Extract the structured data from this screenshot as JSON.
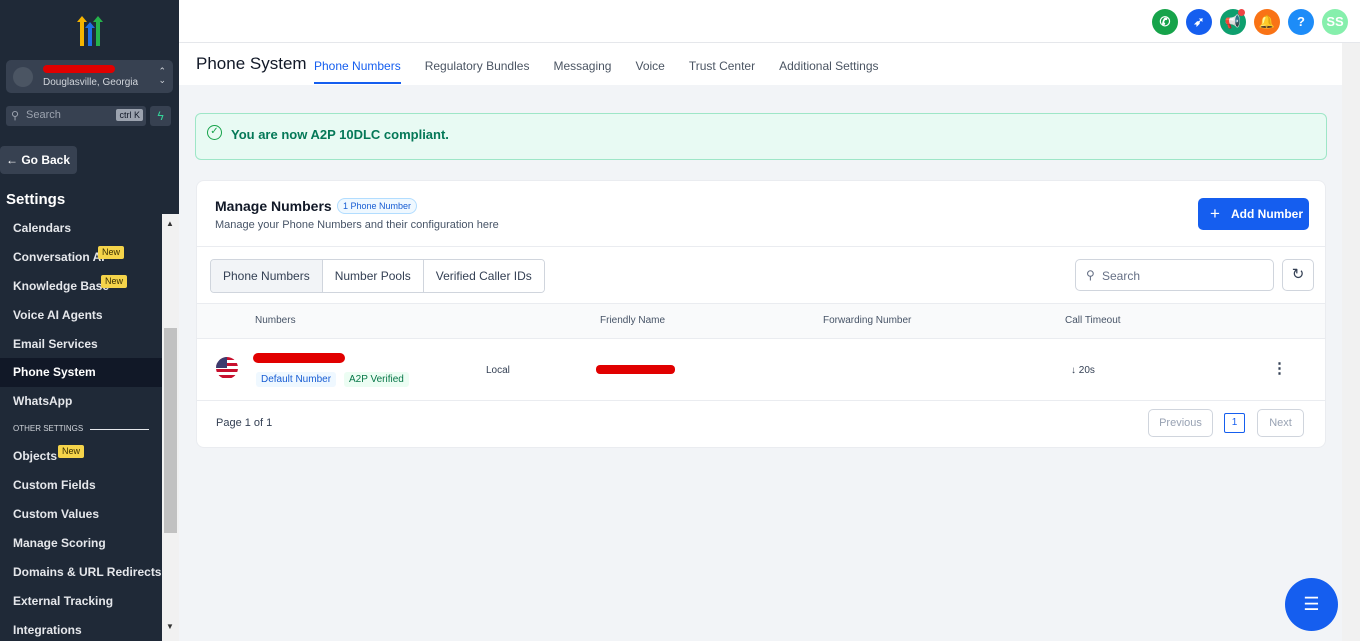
{
  "sidebar": {
    "account_location": "Douglasville, Georgia",
    "search_placeholder": "Search",
    "search_shortcut": "ctrl K",
    "go_back": "← Go Back",
    "settings_title": "Settings",
    "items": [
      {
        "label": "Calendars"
      },
      {
        "label": "Conversation AI",
        "badge": "New"
      },
      {
        "label": "Knowledge Base",
        "badge": "New"
      },
      {
        "label": "Voice AI Agents"
      },
      {
        "label": "Email Services"
      },
      {
        "label": "Phone System",
        "active": true
      },
      {
        "label": "WhatsApp"
      }
    ],
    "other_settings_label": "OTHER SETTINGS",
    "other_items": [
      {
        "label": "Objects",
        "badge": "New"
      },
      {
        "label": "Custom Fields"
      },
      {
        "label": "Custom Values"
      },
      {
        "label": "Manage Scoring"
      },
      {
        "label": "Domains & URL Redirects"
      },
      {
        "label": "External Tracking"
      },
      {
        "label": "Integrations"
      }
    ]
  },
  "topbar": {
    "avatar_initials": "SS",
    "help_label": "?",
    "icons": [
      "phone-icon",
      "rocket-icon",
      "megaphone-icon",
      "bell-icon",
      "help-icon",
      "avatar"
    ]
  },
  "page": {
    "title": "Phone System",
    "tabs": [
      "Phone Numbers",
      "Regulatory Bundles",
      "Messaging",
      "Voice",
      "Trust Center",
      "Additional Settings"
    ],
    "active_tab": "Phone Numbers"
  },
  "alert": {
    "message": "You are now A2P 10DLC compliant."
  },
  "manage": {
    "title": "Manage Numbers",
    "count_badge": "1 Phone Number",
    "subtitle": "Manage your Phone Numbers and their configuration here",
    "add_button": "Add Number",
    "segments": [
      "Phone Numbers",
      "Number Pools",
      "Verified Caller IDs"
    ],
    "search_placeholder": "Search",
    "columns": [
      "Numbers",
      "Friendly Name",
      "Forwarding Number",
      "Call Timeout"
    ],
    "rows": [
      {
        "tag_default": "Default Number",
        "tag_a2p": "A2P Verified",
        "type": "Local",
        "forwarding": "",
        "timeout": "↓ 20s"
      }
    ],
    "pagination": {
      "info": "Page 1 of 1",
      "previous": "Previous",
      "current": "1",
      "next": "Next"
    }
  },
  "colors": {
    "accent": "#155eef",
    "sidebar_bg": "#1f2937",
    "success": "#047857",
    "new_badge": "#f5d44a"
  }
}
